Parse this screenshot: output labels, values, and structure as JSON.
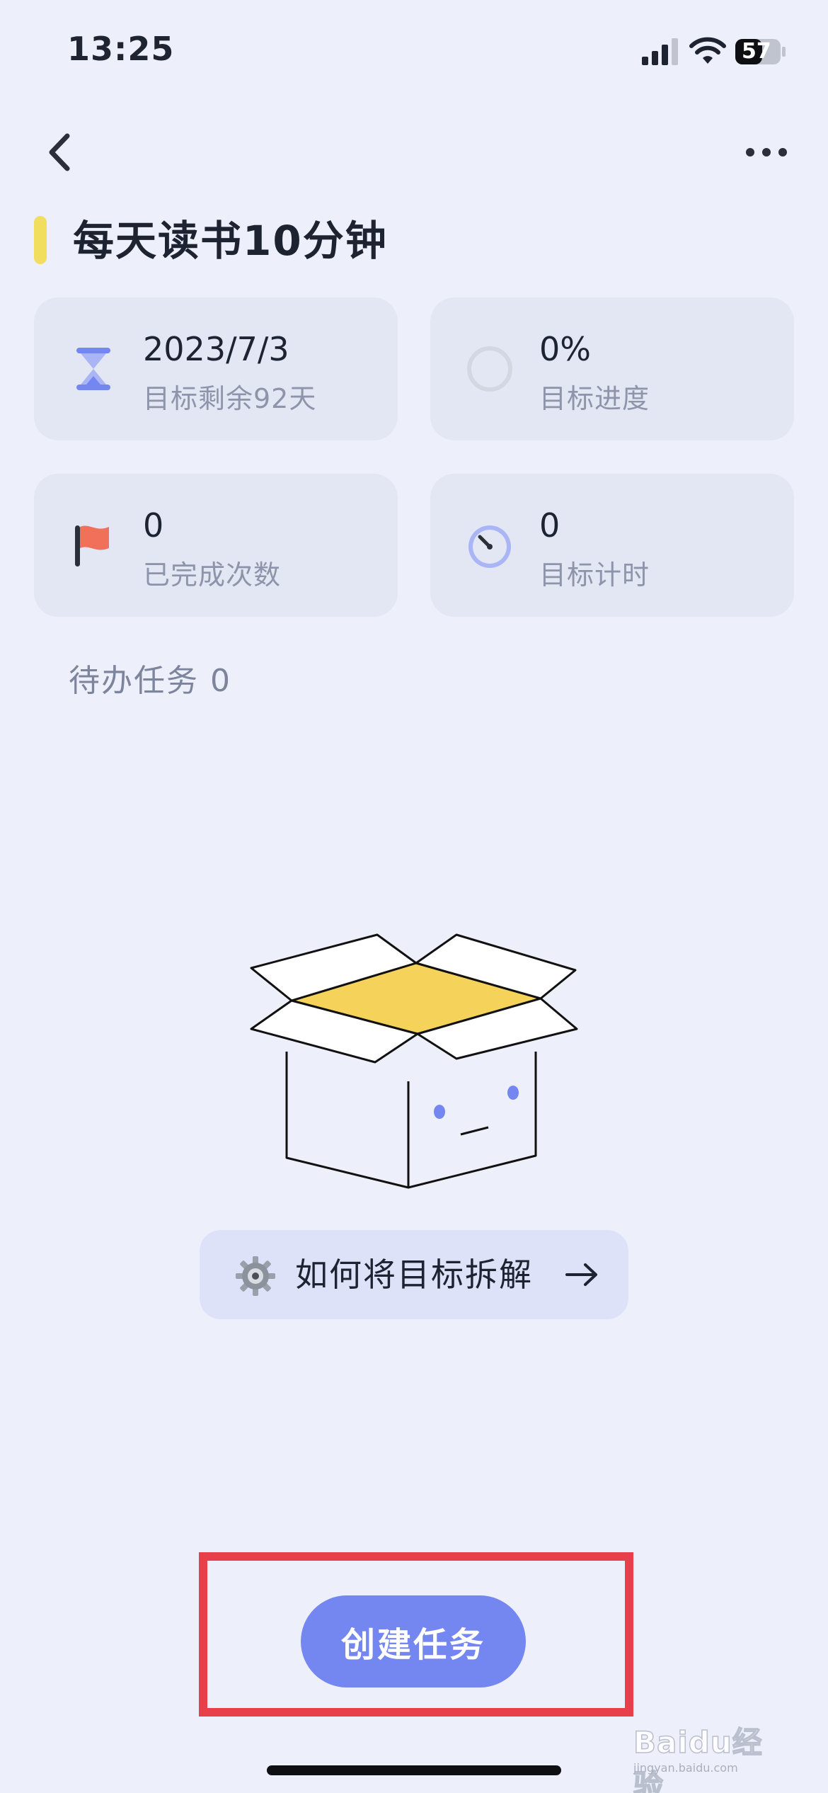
{
  "status_bar": {
    "time": "13:25",
    "battery": "57"
  },
  "nav": {
    "back_icon": "chevron-left-icon",
    "more_icon": "ellipsis-icon"
  },
  "goal": {
    "title": "每天读书10分钟",
    "accent_color": "#F1DD5E"
  },
  "stats": [
    {
      "icon": "hourglass-icon",
      "value": "2023/7/3",
      "label": "目标剩余92天"
    },
    {
      "icon": "progress-ring-icon",
      "value": "0%",
      "label": "目标进度"
    },
    {
      "icon": "flag-icon",
      "value": "0",
      "label": "已完成次数"
    },
    {
      "icon": "timer-icon",
      "value": "0",
      "label": "目标计时"
    }
  ],
  "pending": {
    "label": "待办任务 0"
  },
  "empty_state": {
    "icon": "empty-box-icon"
  },
  "guide": {
    "icon": "gear-icon",
    "label": "如何将目标拆解",
    "arrow_icon": "arrow-right-icon"
  },
  "create_button": {
    "label": "创建任务",
    "color": "#7486F0"
  },
  "annotation": {
    "highlight_color": "#E8404A"
  },
  "watermark": {
    "text": "Baidu经验",
    "sub": "jingyan.baidu.com"
  }
}
